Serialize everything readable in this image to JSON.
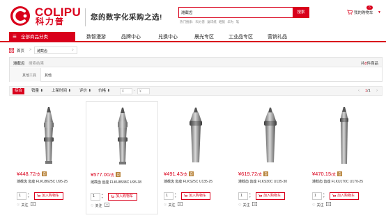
{
  "brand": {
    "name_en": "COLIPU",
    "name_cn": "科力普",
    "slogan": "您的数字化采购之选!",
    "color": "#d9001b"
  },
  "search": {
    "value": "潍截齿",
    "button_label": "搜索",
    "hot_prefix": "热门搜索:",
    "hot_words": [
      "科力普",
      "复印纸",
      "硒鼓",
      "华为",
      "笔"
    ]
  },
  "cart": {
    "label": "我的购物车",
    "count": "0"
  },
  "nav": {
    "all_categories": "全部商品分类",
    "items": [
      "数智漫游",
      "品牌中心",
      "兑换中心",
      "晨光专区",
      "工业品专区",
      "营销礼品"
    ]
  },
  "breadcrumb": {
    "home": "首页",
    "separator": ">",
    "current": "潍截齿"
  },
  "filter": {
    "keyword": "潍截齿",
    "result_label": "搜索结果",
    "count_prefix": "共",
    "count": "8",
    "count_suffix": "件商品",
    "row_label": "其他工具",
    "row_value": "其他"
  },
  "sort": {
    "items": [
      "综合",
      "销量 ⬇",
      "上架时间 ⬇",
      "评价 ⬇",
      "价格 ⬇"
    ],
    "price_min_placeholder": "¥",
    "price_max_placeholder": "¥",
    "price_dash": "-",
    "page_current": "1",
    "page_total": "/1"
  },
  "products": [
    {
      "price": "¥448.72",
      "unit": "/支",
      "tag": "自",
      "title": "潍截齿 齿座 FLKU8625C U95-25",
      "qty": "1",
      "add_label": "加入购物车",
      "follow_label": "关注"
    },
    {
      "price": "¥577.00",
      "unit": "/支",
      "tag": "自",
      "title": "潍截齿 齿座 FLKU8538C U95-38",
      "qty": "1",
      "add_label": "加入购物车",
      "follow_label": "关注"
    },
    {
      "price": "¥491.43",
      "unit": "/支",
      "tag": "自",
      "title": "潍截齿 齿座 FLKS25C U135-25",
      "qty": "1",
      "add_label": "加入购物车",
      "follow_label": "关注"
    },
    {
      "price": "¥619.72",
      "unit": "/支",
      "tag": "自",
      "title": "潍截齿 齿座 FLKS30C U135-30",
      "qty": "1",
      "add_label": "加入购物车",
      "follow_label": "关注"
    },
    {
      "price": "¥470.15",
      "unit": "/支",
      "tag": "自",
      "title": "潍截齿 齿座 FLKU170C U170-25",
      "qty": "1",
      "add_label": "加入购物车",
      "follow_label": "关注"
    }
  ]
}
